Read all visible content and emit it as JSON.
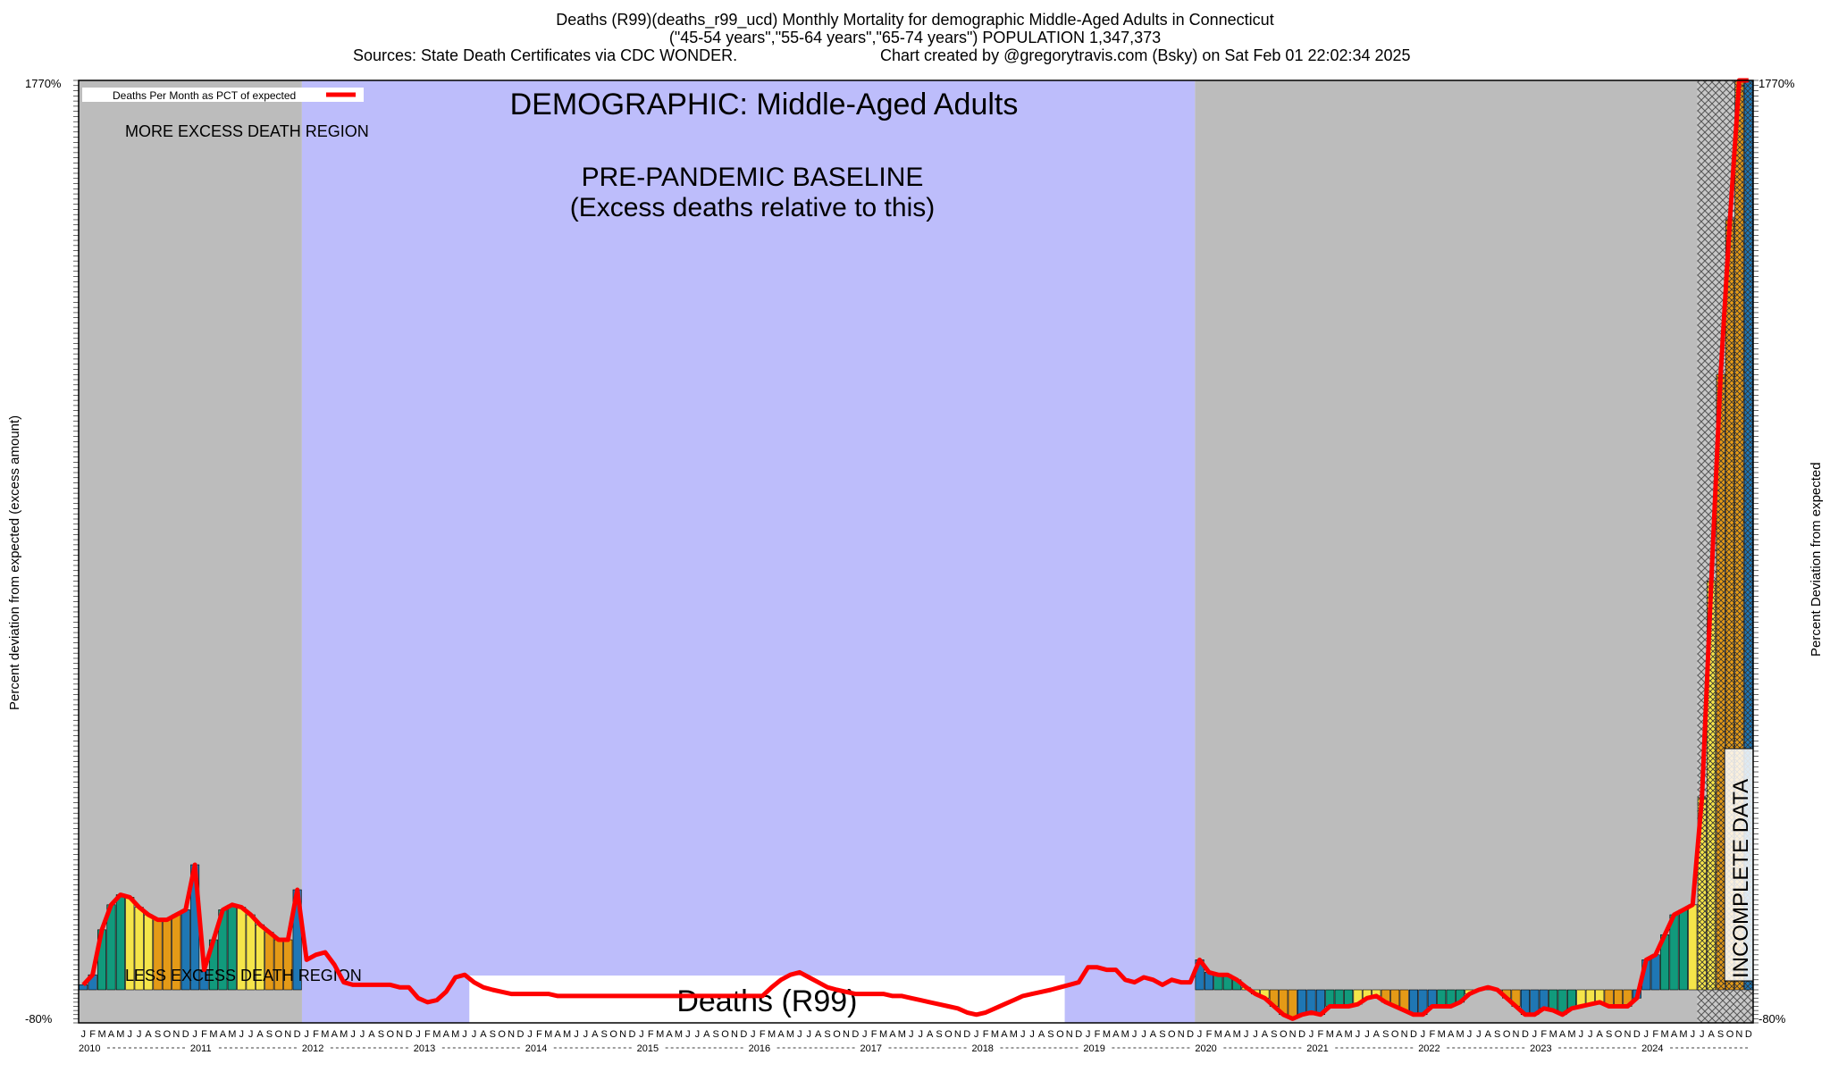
{
  "header": {
    "line1": "Deaths (R99)(deaths_r99_ucd) Monthly Mortality for demographic Middle-Aged Adults in Connecticut",
    "line2": "(\"45-54 years\",\"55-64 years\",\"65-74 years\") POPULATION 1,347,373",
    "line3_left": "Sources: State Death Certificates via CDC WONDER.",
    "line3_right": "Chart created by @gregorytravis.com (Bsky) on Sat Feb 01 22:02:34 2025"
  },
  "colors": {
    "gray_region": "#bcbcbc",
    "baseline_region": "#bdbdfb",
    "line": "#ff0000",
    "bar_winter": "#1f77b4",
    "bar_spring": "#119a7c",
    "bar_summer": "#f5e54a",
    "bar_fall": "#e49a17"
  },
  "chart_data": {
    "type": "bar",
    "title": "Deaths (R99)",
    "ylabel": "Percent deviation from expected (excess amount)",
    "ylabel_right": "Percent Deviation from expected",
    "legend": "Deaths Per Month as PCT of expected",
    "legend_position": "top-left",
    "annotations": {
      "demographic": "DEMOGRAPHIC: Middle-Aged Adults",
      "baseline_line1": "PRE-PANDEMIC BASELINE",
      "baseline_line2": "(Excess deaths relative to this)",
      "more_region": "MORE EXCESS DEATH REGION",
      "less_region": "LESS EXCESS DEATH REGION",
      "incomplete": "INCOMPLETE DATA"
    },
    "y_tick_label_top": "1770%",
    "y_tick_label_bottom": "-80%",
    "ylim": [
      -80,
      1770
    ],
    "month_letters": [
      "J",
      "F",
      "M",
      "A",
      "M",
      "J",
      "J",
      "A",
      "S",
      "O",
      "N",
      "D"
    ],
    "years": [
      "2010",
      "2011",
      "2012",
      "2013",
      "2014",
      "2015",
      "2016",
      "2017",
      "2018",
      "2019",
      "2020",
      "2021",
      "2022",
      "2023",
      "2024"
    ],
    "baseline_period": [
      "2012-01",
      "2019-12"
    ],
    "incomplete_from": "2024-07",
    "values_by_year": {
      "2010": [
        10,
        30,
        120,
        170,
        190,
        185,
        165,
        150,
        140,
        140,
        150,
        160
      ],
      "2011": [
        250,
        40,
        100,
        160,
        170,
        165,
        150,
        130,
        115,
        100,
        100,
        200
      ],
      "2012": [
        60,
        70,
        75,
        50,
        15,
        10,
        10,
        10,
        10,
        10,
        5,
        5
      ],
      "2013": [
        -20,
        -30,
        -25,
        -5,
        25,
        30,
        15,
        5,
        0,
        -5,
        -10,
        -10
      ],
      "2014": [
        -10,
        -10,
        -10,
        -15,
        -15,
        -15,
        -15,
        -15,
        -15,
        -15,
        -15,
        -15
      ],
      "2015": [
        -15,
        -15,
        -15,
        -15,
        -15,
        -15,
        -15,
        -15,
        -15,
        -15,
        -15,
        -15
      ],
      "2016": [
        -15,
        -15,
        5,
        20,
        30,
        35,
        25,
        15,
        5,
        0,
        -5,
        -10
      ],
      "2017": [
        -10,
        -10,
        -10,
        -15,
        -15,
        -20,
        -25,
        -30,
        -35,
        -40,
        -45,
        -55
      ],
      "2018": [
        -60,
        -55,
        -45,
        -35,
        -25,
        -15,
        -10,
        -5,
        0,
        5,
        10,
        15
      ],
      "2019": [
        45,
        45,
        40,
        40,
        20,
        15,
        25,
        20,
        10,
        20,
        15,
        15
      ],
      "2020": [
        60,
        35,
        30,
        30,
        20,
        5,
        -10,
        -20,
        -40,
        -60,
        -70,
        -60
      ],
      "2021": [
        -55,
        -60,
        -40,
        -40,
        -40,
        -35,
        -20,
        -15,
        -30,
        -40,
        -50,
        -60
      ],
      "2022": [
        -60,
        -40,
        -40,
        -40,
        -30,
        -10,
        0,
        5,
        0,
        -20,
        -40,
        -60
      ],
      "2023": [
        -60,
        -45,
        -50,
        -60,
        -45,
        -40,
        -35,
        -30,
        -40,
        -40,
        -40,
        -20
      ],
      "2024": [
        60,
        70,
        110,
        150,
        160,
        170,
        380,
        800,
        1200,
        1500,
        1770,
        1770
      ]
    }
  },
  "x_axis": {
    "title": "Deaths (R99)"
  }
}
